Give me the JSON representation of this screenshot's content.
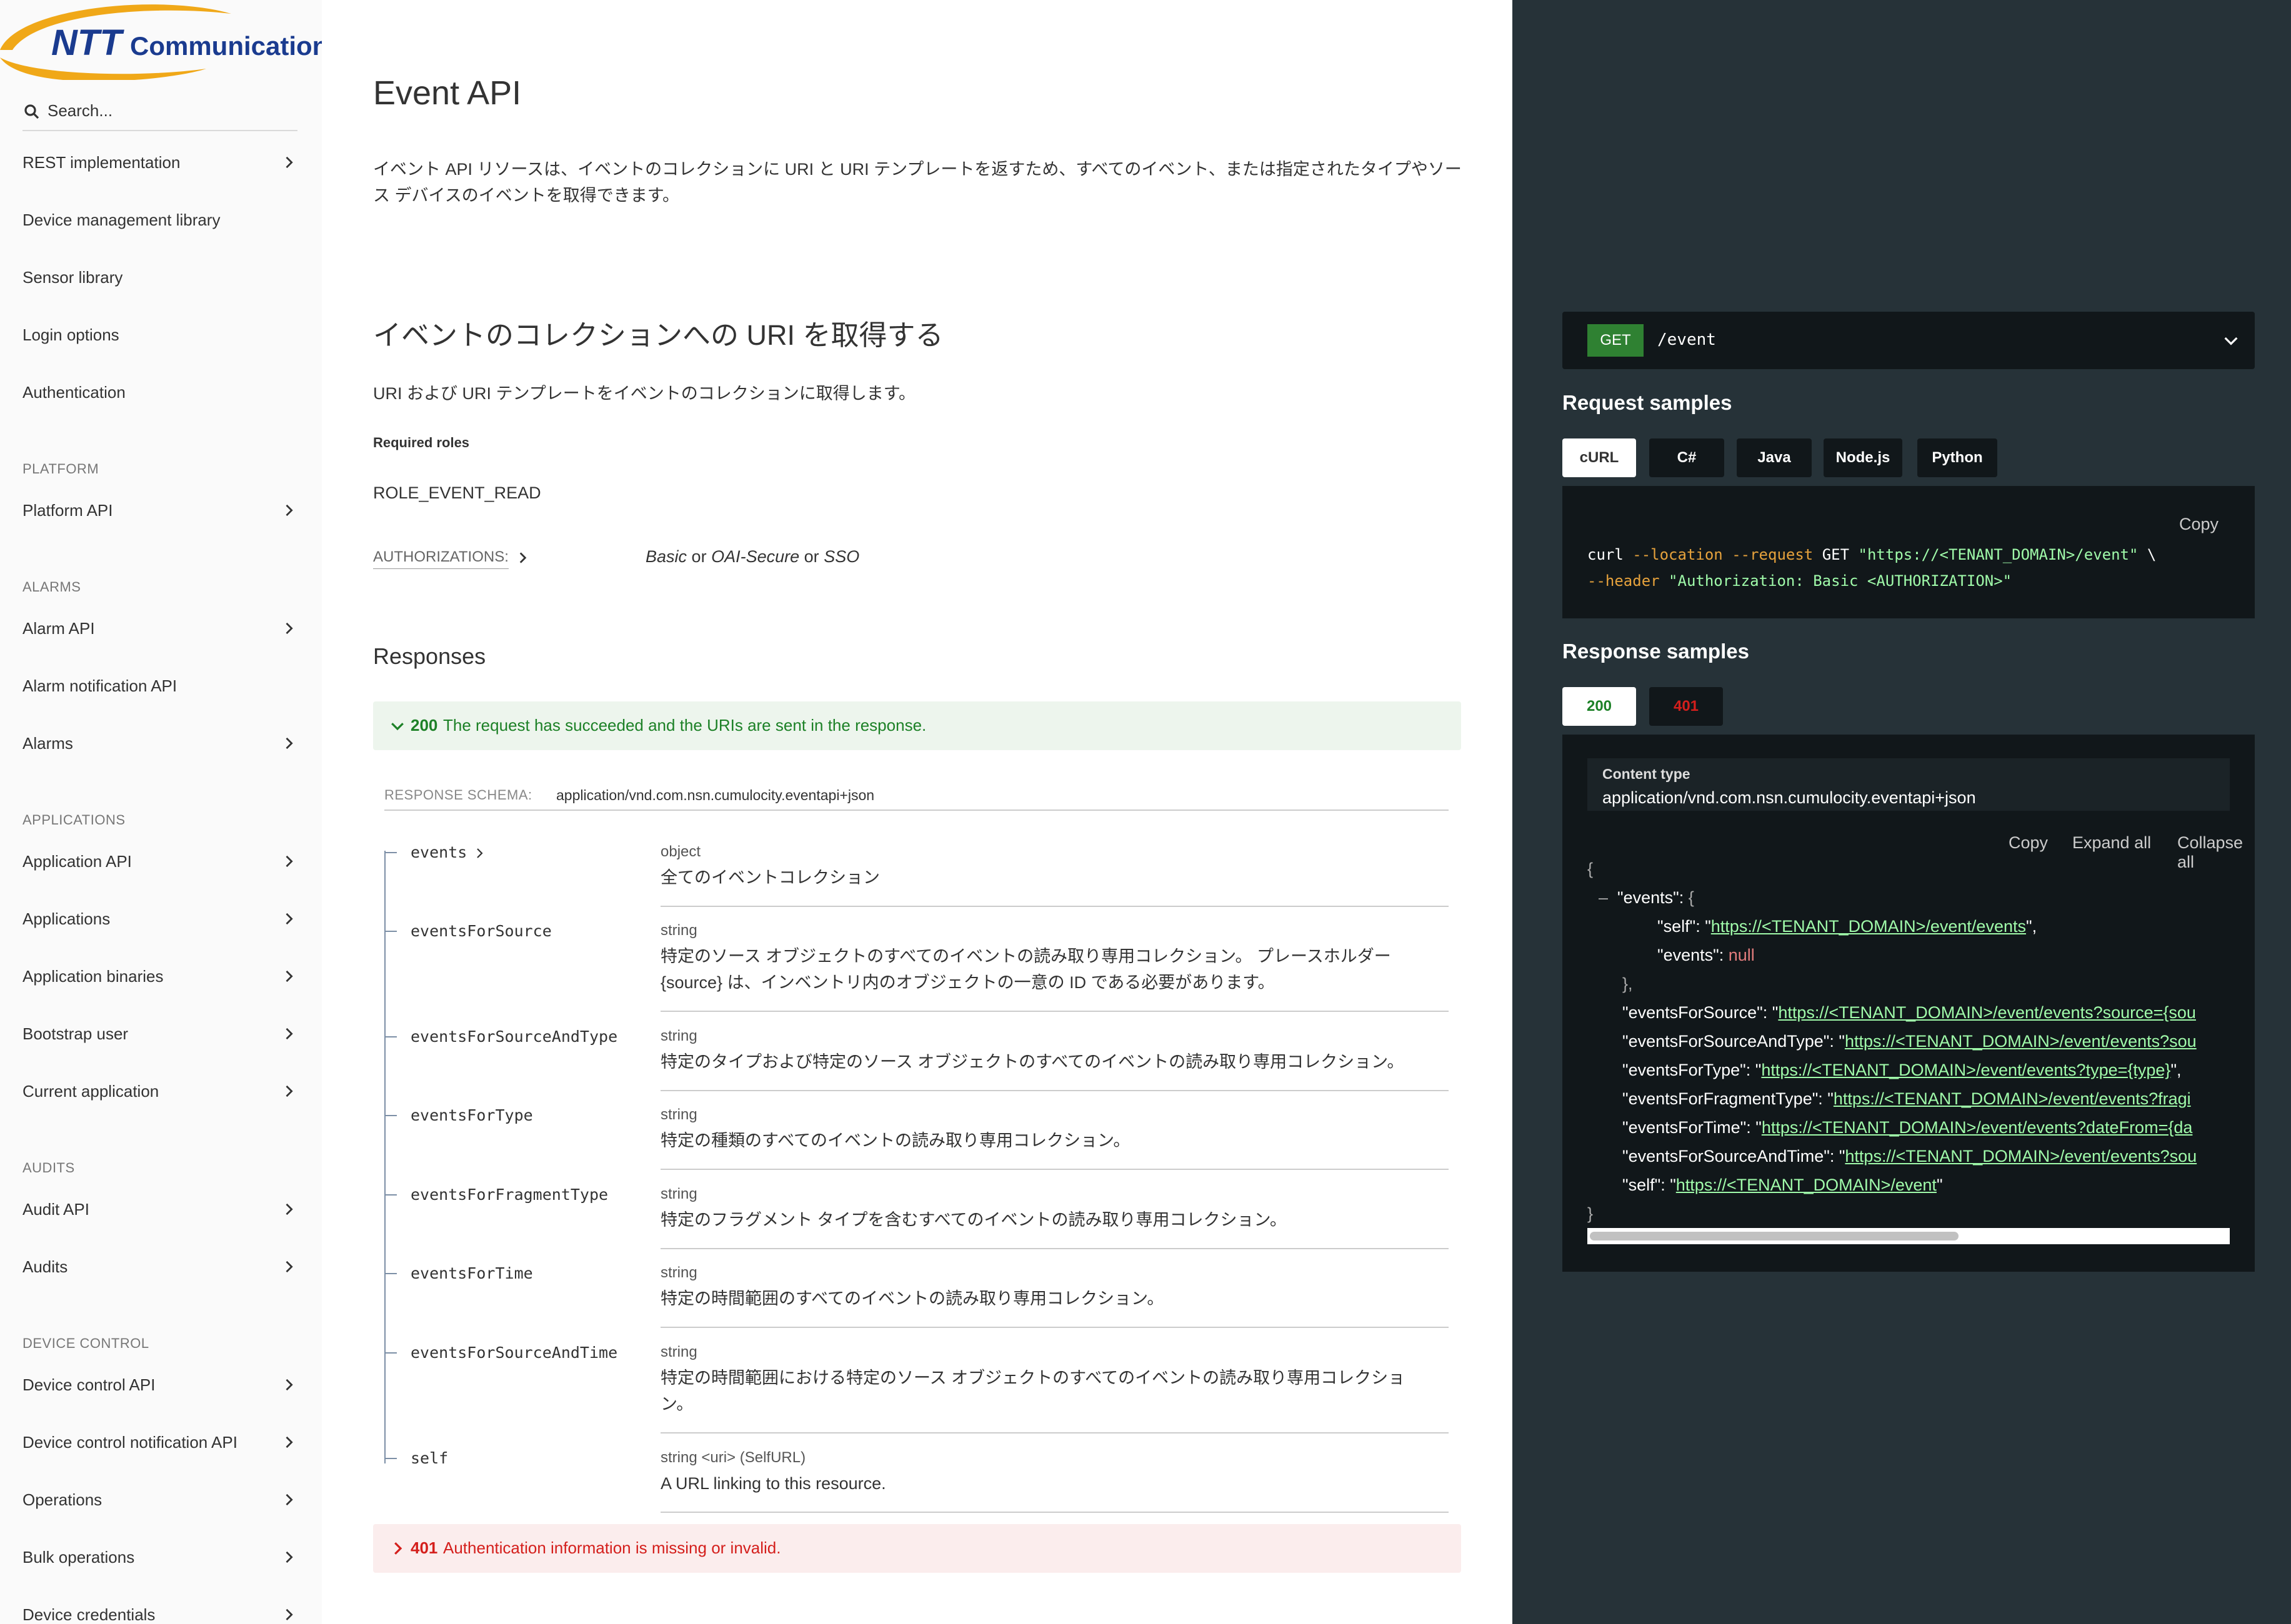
{
  "sidebar": {
    "logo_text": "NTT Communications",
    "search_placeholder": "Search...",
    "items_top": [
      {
        "label": "REST implementation",
        "chevron": true
      },
      {
        "label": "Device management library",
        "chevron": false
      },
      {
        "label": "Sensor library",
        "chevron": false
      },
      {
        "label": "Login options",
        "chevron": false
      },
      {
        "label": "Authentication",
        "chevron": false
      }
    ],
    "groups": {
      "platform": "PLATFORM",
      "alarms": "ALARMS",
      "applications": "APPLICATIONS",
      "audits": "AUDITS",
      "device_control": "DEVICE CONTROL"
    },
    "platform_items": [
      {
        "label": "Platform API",
        "chevron": true
      }
    ],
    "alarms_items": [
      {
        "label": "Alarm API",
        "chevron": true
      },
      {
        "label": "Alarm notification API",
        "chevron": false
      },
      {
        "label": "Alarms",
        "chevron": true
      }
    ],
    "applications_items": [
      {
        "label": "Application API",
        "chevron": true
      },
      {
        "label": "Applications",
        "chevron": true
      },
      {
        "label": "Application binaries",
        "chevron": true
      },
      {
        "label": "Bootstrap user",
        "chevron": true
      },
      {
        "label": "Current application",
        "chevron": true
      }
    ],
    "audits_items": [
      {
        "label": "Audit API",
        "chevron": true
      },
      {
        "label": "Audits",
        "chevron": true
      }
    ],
    "device_control_items": [
      {
        "label": "Device control API",
        "chevron": true
      },
      {
        "label": "Device control notification API",
        "chevron": true
      },
      {
        "label": "Operations",
        "chevron": true
      },
      {
        "label": "Bulk operations",
        "chevron": true
      },
      {
        "label": "Device credentials",
        "chevron": true
      }
    ]
  },
  "main": {
    "title": "Event API",
    "description": "イベント API リソースは、イベントのコレクションに URI と URI テンプレートを返すため、すべてのイベント、または指定されたタイプやソース デバイスのイベントを取得できます。",
    "operation_title": "イベントのコレクションへの URI を取得する",
    "operation_desc": "URI および URI テンプレートをイベントのコレクションに取得します。",
    "roles_label": "Required roles",
    "roles_value": "ROLE_EVENT_READ",
    "auth_label": "AUTHORIZATIONS:",
    "auth_basic": "Basic",
    "auth_or": "or",
    "auth_oai": "OAI-Secure",
    "auth_sso": "SSO",
    "responses_title": "Responses",
    "resp200_code": "200",
    "resp200_msg": "The request has succeeded and the URIs are sent in the response.",
    "schema_label": "RESPONSE SCHEMA:",
    "schema_value": "application/vnd.com.nsn.cumulocity.eventapi+json",
    "fields": [
      {
        "name": "events",
        "type": "object",
        "desc": "全てのイベントコレクション",
        "expandable": true
      },
      {
        "name": "eventsForSource",
        "type": "string",
        "desc": "特定のソース オブジェクトのすべてのイベントの読み取り専用コレクション。 プレースホルダー {source} は、インベントリ内のオブジェクトの一意の ID である必要があります。",
        "expandable": false
      },
      {
        "name": "eventsForSourceAndType",
        "type": "string",
        "desc": "特定のタイプおよび特定のソース オブジェクトのすべてのイベントの読み取り専用コレクション。",
        "expandable": false
      },
      {
        "name": "eventsForType",
        "type": "string",
        "desc": "特定の種類のすべてのイベントの読み取り専用コレクション。",
        "expandable": false
      },
      {
        "name": "eventsForFragmentType",
        "type": "string",
        "desc": "特定のフラグメント タイプを含むすべてのイベントの読み取り専用コレクション。",
        "expandable": false
      },
      {
        "name": "eventsForTime",
        "type": "string",
        "desc": "特定の時間範囲のすべてのイベントの読み取り専用コレクション。",
        "expandable": false
      },
      {
        "name": "eventsForSourceAndTime",
        "type": "string",
        "desc": "特定の時間範囲における特定のソース オブジェクトのすべてのイベントの読み取り専用コレクション。",
        "expandable": false
      },
      {
        "name": "self",
        "type": "string <uri> (SelfURL)",
        "desc": "A URL linking to this resource.",
        "expandable": false
      }
    ],
    "resp401_code": "401",
    "resp401_msg": "Authentication information is missing or invalid."
  },
  "right": {
    "method": "GET",
    "path": "/event",
    "request_samples_title": "Request samples",
    "lang_tabs": [
      "cURL",
      "C#",
      "Java",
      "Node.js",
      "Python"
    ],
    "active_lang": "cURL",
    "copy_label": "Copy",
    "curl": {
      "cmd": "curl",
      "opt_location": "--location",
      "opt_request": "--request",
      "verb": "GET",
      "url": "\"https://<TENANT_DOMAIN>/event\"",
      "backslash": "\\",
      "opt_header": "--header",
      "header": "\"Authorization: Basic <AUTHORIZATION>\""
    },
    "response_samples_title": "Response samples",
    "status_tabs": [
      "200",
      "401"
    ],
    "content_type_label": "Content type",
    "content_type_value": "application/vnd.com.nsn.cumulocity.eventapi+json",
    "json_buttons": {
      "copy": "Copy",
      "expand": "Expand all",
      "collapse": "Collapse all"
    },
    "json": {
      "events_key": "\"events\"",
      "self_key": "\"self\"",
      "self_events_url": "https://<TENANT_DOMAIN>/event/events",
      "events_inner_key": "\"events\"",
      "null": "null",
      "eventsForSource_key": "\"eventsForSource\"",
      "eventsForSource_url": "https://<TENANT_DOMAIN>/event/events?source={sou",
      "eventsForSourceAndType_key": "\"eventsForSourceAndType\"",
      "eventsForSourceAndType_url": "https://<TENANT_DOMAIN>/event/events?sou",
      "eventsForType_key": "\"eventsForType\"",
      "eventsForType_url": "https://<TENANT_DOMAIN>/event/events?type={type}",
      "eventsForFragmentType_key": "\"eventsForFragmentType\"",
      "eventsForFragmentType_url": "https://<TENANT_DOMAIN>/event/events?fragi",
      "eventsForTime_key": "\"eventsForTime\"",
      "eventsForTime_url": "https://<TENANT_DOMAIN>/event/events?dateFrom={da",
      "eventsForSourceAndTime_key": "\"eventsForSourceAndTime\"",
      "eventsForSourceAndTime_url": "https://<TENANT_DOMAIN>/event/events?sou",
      "self_root_key": "\"self\"",
      "self_root_url": "https://<TENANT_DOMAIN>/event"
    }
  },
  "colors": {
    "sidebar_bg": "#fafafa",
    "right_bg": "#263238",
    "code_bg": "#11171a",
    "success": "#1d8127",
    "error": "#d41f1c",
    "link": "#a0fbaa",
    "brand_blue": "#1a3b8f",
    "brand_orange": "#f0a818"
  }
}
